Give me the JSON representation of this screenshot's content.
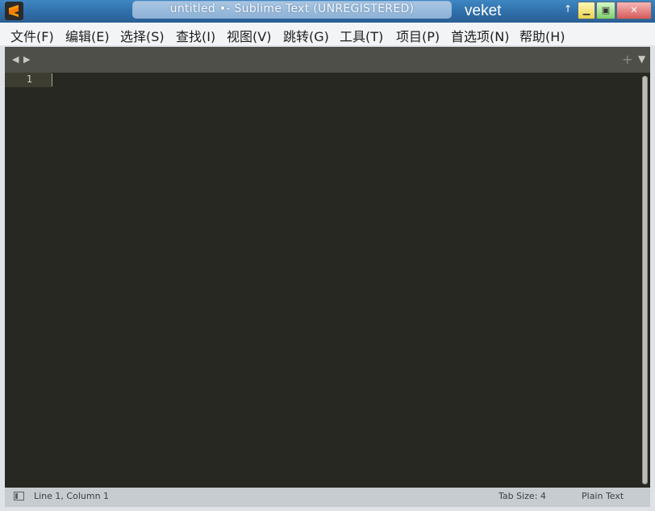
{
  "window": {
    "title": "untitled  •- Sublime Text (UNREGISTERED)",
    "host": "veket",
    "extra_icon": "↑",
    "minimize_icon": "minimize-icon",
    "maximize_icon": "maximize-icon",
    "close_icon": "close-icon",
    "close_label": "✕",
    "minimize_label": "▁",
    "maximize_label": "▣"
  },
  "menu": {
    "items": [
      {
        "label": "文件(F)"
      },
      {
        "label": "编辑(E)"
      },
      {
        "label": "选择(S)"
      },
      {
        "label": "查找(I)"
      },
      {
        "label": "视图(V)"
      },
      {
        "label": "跳转(G)"
      },
      {
        "label": "工具(T)"
      },
      {
        "label": "项目(P)"
      },
      {
        "label": "首选项(N)"
      },
      {
        "label": "帮助(H)"
      }
    ]
  },
  "tabbar": {
    "back_glyph": "◀",
    "forward_glyph": "▶",
    "add_glyph": "+",
    "list_glyph": "▼"
  },
  "editor": {
    "line_number": "1",
    "theme_colors": {
      "background": "#272822",
      "gutter_highlight": "#3e3d32",
      "line_number": "#cfcfc2"
    }
  },
  "statusbar": {
    "position": "Line 1, Column 1",
    "tab_size": "Tab Size: 4",
    "syntax": "Plain Text"
  }
}
